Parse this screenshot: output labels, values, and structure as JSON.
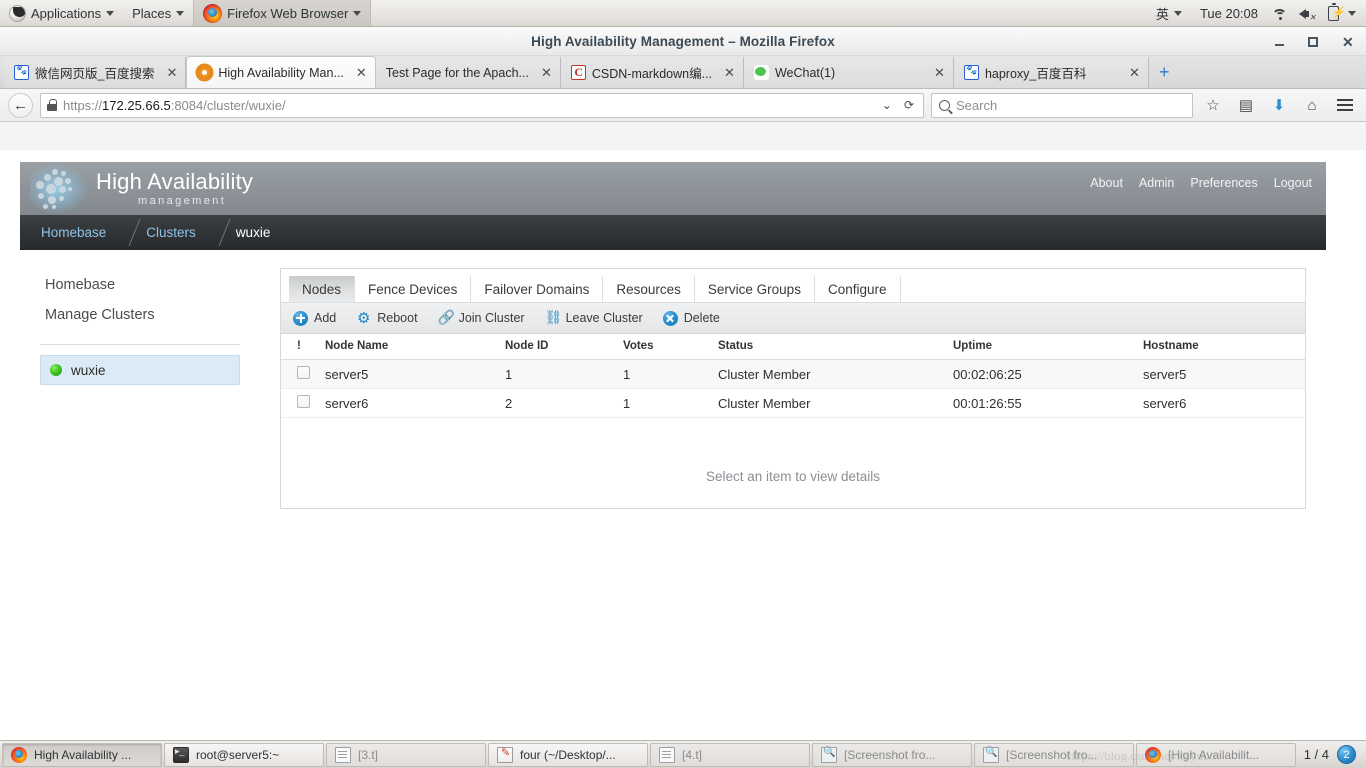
{
  "desktop": {
    "panel": {
      "applications": "Applications",
      "places": "Places",
      "active_window": "Firefox Web Browser",
      "input_method": "英",
      "clock": "Tue 20:08",
      "icons": [
        "wifi-icon",
        "volume-muted-icon",
        "battery-charging-icon"
      ]
    },
    "taskbar": {
      "items": [
        {
          "label": "High Availability ...",
          "icon": "firefox-icon",
          "state": "pressed"
        },
        {
          "label": "root@server5:~",
          "icon": "terminal-icon",
          "state": "normal"
        },
        {
          "label": "[3.t]",
          "icon": "document-icon",
          "state": "dim"
        },
        {
          "label": "four (~/Desktop/...",
          "icon": "notepad-icon",
          "state": "normal"
        },
        {
          "label": "[4.t]",
          "icon": "document-icon",
          "state": "dim"
        },
        {
          "label": "[Screenshot fro...",
          "icon": "screenshot-icon",
          "state": "dim"
        },
        {
          "label": "[Screenshot fro...",
          "icon": "screenshot-icon",
          "state": "dim"
        },
        {
          "label": "[High Availabilit...",
          "icon": "firefox-icon",
          "state": "dim"
        }
      ],
      "workspace_label": "1 / 4",
      "workspace_number": "2",
      "watermark": "https://blog.csdn.net/xuyubo"
    }
  },
  "browser": {
    "window_title": "High Availability Management – Mozilla Firefox",
    "window_buttons": [
      "minimize-icon",
      "maximize-icon",
      "close-icon"
    ],
    "tabs": [
      {
        "label": "微信网页版_百度搜索",
        "favicon": "baidu-icon",
        "selected": false
      },
      {
        "label": "High Availability Man...",
        "favicon": "gear-icon",
        "selected": true
      },
      {
        "label": "Test Page for the Apach...",
        "favicon": "blank-icon",
        "selected": false
      },
      {
        "label": "CSDN-markdown编...",
        "favicon": "csdn-icon",
        "selected": false
      },
      {
        "label": "WeChat(1)",
        "favicon": "wechat-icon",
        "selected": false
      },
      {
        "label": "haproxy_百度百科",
        "favicon": "baidu-icon",
        "selected": false
      }
    ],
    "new_tab_label": "+",
    "tab_close_label": "✕",
    "url": {
      "scheme": "https://",
      "host": "172.25.66.5",
      "rest": ":8084/cluster/wuxie/"
    },
    "search_placeholder": "Search",
    "nav_icons": [
      "back-icon",
      "lock-icon",
      "dropdown-icon",
      "reload-icon",
      "search-icon",
      "bookmark-star-icon",
      "library-icon",
      "downloads-icon",
      "home-icon",
      "menu-icon"
    ]
  },
  "app": {
    "brand": {
      "title": "High Availability",
      "subtitle": "management"
    },
    "top_nav": [
      "About",
      "Admin",
      "Preferences",
      "Logout"
    ],
    "breadcrumb": [
      {
        "label": "Homebase",
        "current": false
      },
      {
        "label": "Clusters",
        "current": false
      },
      {
        "label": "wuxie",
        "current": true
      }
    ],
    "sidebar": {
      "links": [
        "Homebase",
        "Manage Clusters"
      ],
      "clusters": [
        {
          "label": "wuxie",
          "status": "online",
          "selected": true
        }
      ]
    },
    "tabs": [
      {
        "label": "Nodes",
        "active": true
      },
      {
        "label": "Fence Devices",
        "active": false
      },
      {
        "label": "Failover Domains",
        "active": false
      },
      {
        "label": "Resources",
        "active": false
      },
      {
        "label": "Service Groups",
        "active": false
      },
      {
        "label": "Configure",
        "active": false
      }
    ],
    "toolbar": [
      {
        "label": "Add",
        "icon": "plus-circle-icon"
      },
      {
        "label": "Reboot",
        "icon": "power-gear-icon"
      },
      {
        "label": "Join Cluster",
        "icon": "link-icon"
      },
      {
        "label": "Leave Cluster",
        "icon": "broken-link-icon"
      },
      {
        "label": "Delete",
        "icon": "x-circle-icon"
      }
    ],
    "table": {
      "columns": [
        "!",
        "Node Name",
        "Node ID",
        "Votes",
        "Status",
        "Uptime",
        "Hostname"
      ],
      "rows": [
        {
          "name": "server5",
          "node_id": "1",
          "votes": "1",
          "status": "Cluster Member",
          "uptime": "00:02:06:25",
          "hostname": "server5"
        },
        {
          "name": "server6",
          "node_id": "2",
          "votes": "1",
          "status": "Cluster Member",
          "uptime": "00:01:26:55",
          "hostname": "server6"
        }
      ]
    },
    "details_placeholder": "Select an item to view details",
    "colors": {
      "accent": "#2a8fcf",
      "header_gray": "#8e9499",
      "crumb_link": "#8fc3e6",
      "status_online": "#3fc522"
    }
  }
}
